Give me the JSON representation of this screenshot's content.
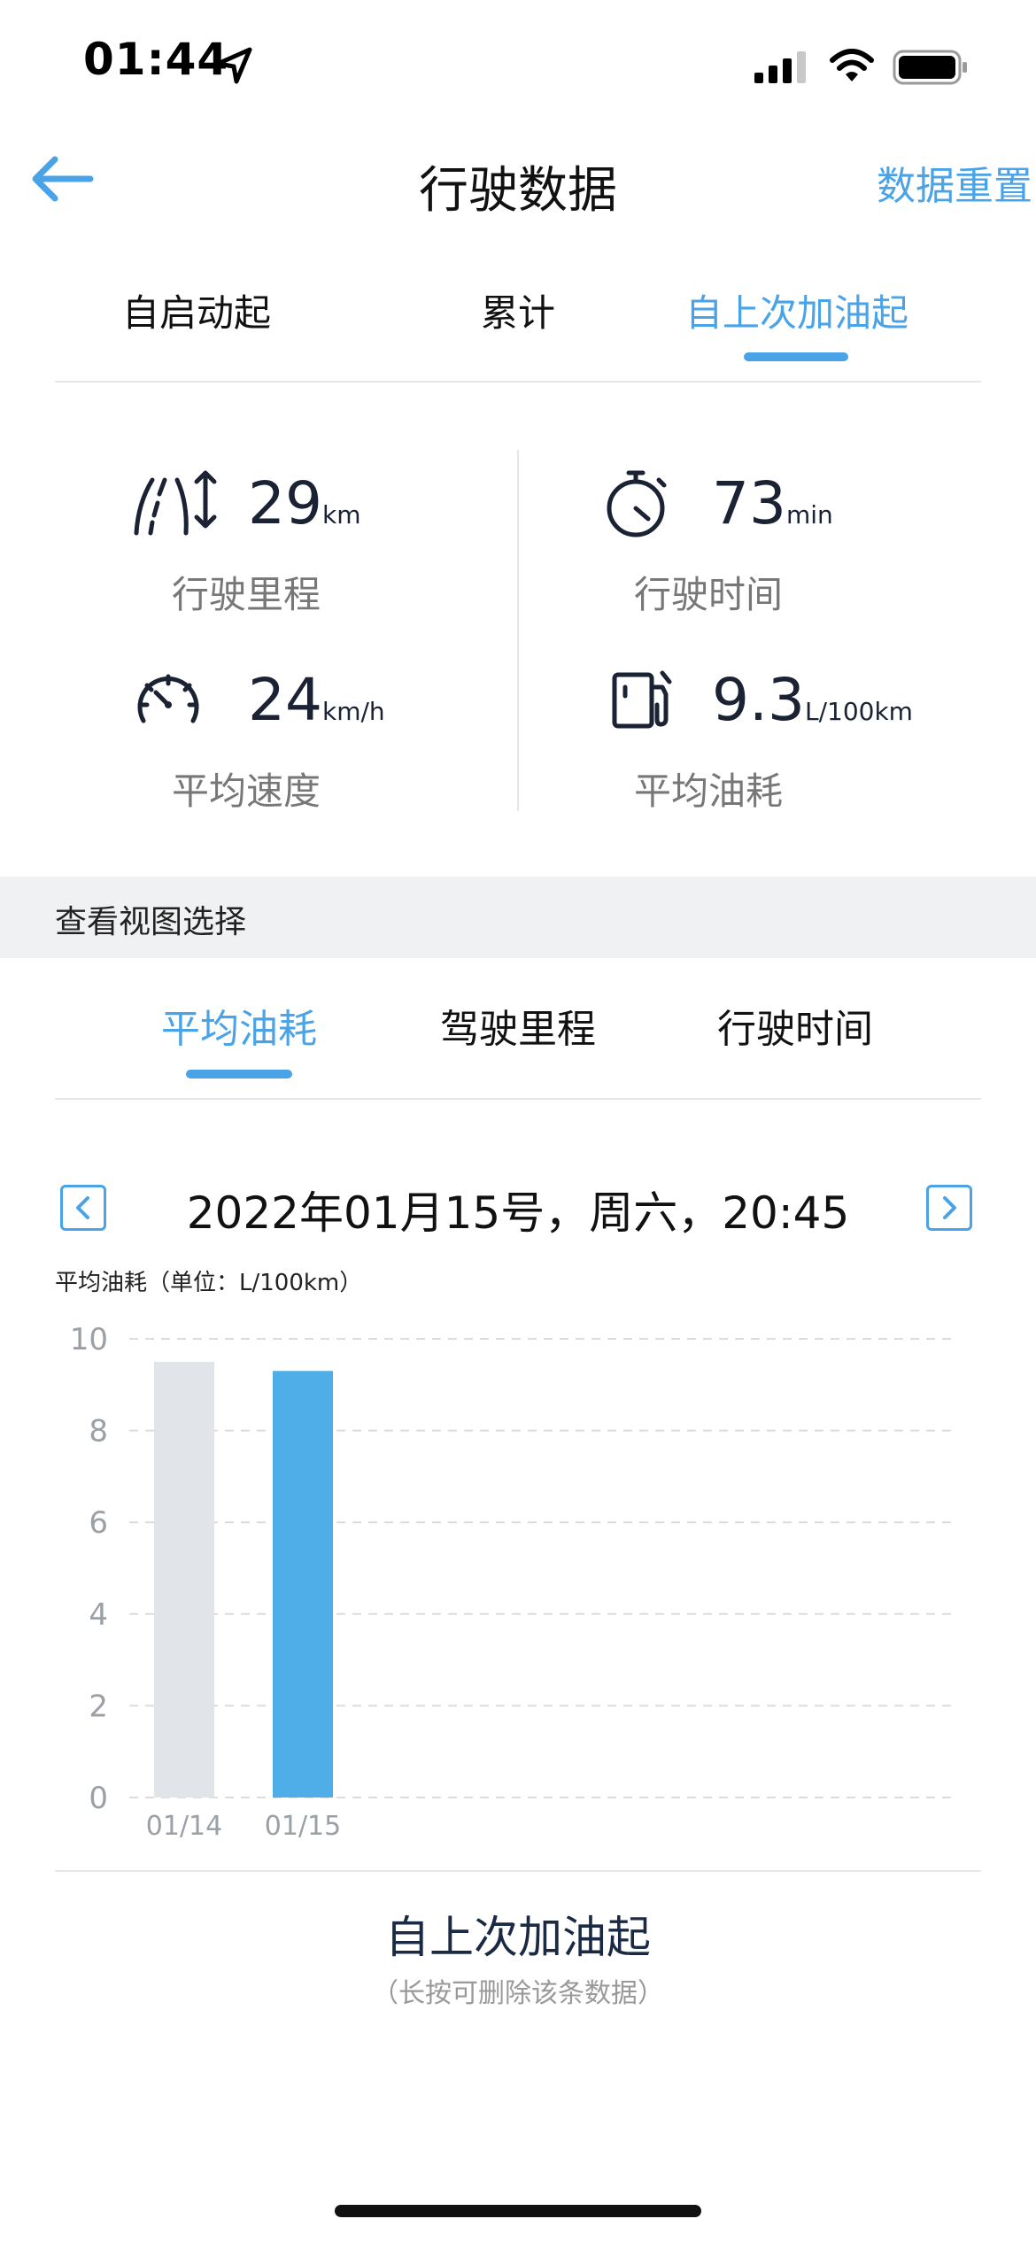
{
  "status_bar": {
    "time": "01:44"
  },
  "nav": {
    "title": "行驶数据",
    "reset_label": "数据重置"
  },
  "top_tabs": [
    {
      "label": "自启动起",
      "active": false
    },
    {
      "label": "累计",
      "active": false
    },
    {
      "label": "自上次加油起",
      "active": true
    }
  ],
  "stats": {
    "distance": {
      "value": "29",
      "unit": "km",
      "label": "行驶里程",
      "icon": "road-distance-icon"
    },
    "time": {
      "value": "73",
      "unit": "min",
      "label": "行驶时间",
      "icon": "stopwatch-icon"
    },
    "speed": {
      "value": "24",
      "unit": "km/h",
      "label": "平均速度",
      "icon": "speedometer-icon"
    },
    "fuel": {
      "value": "9.3",
      "unit": "L/100km",
      "label": "平均油耗",
      "icon": "fuel-pump-icon"
    }
  },
  "view_section": {
    "label": "查看视图选择"
  },
  "view_tabs": [
    {
      "label": "平均油耗",
      "active": true
    },
    {
      "label": "驾驶里程",
      "active": false
    },
    {
      "label": "行驶时间",
      "active": false
    }
  ],
  "date_selector": {
    "text": "2022年01月15号，周六，20:45"
  },
  "chart_data": {
    "type": "bar",
    "title": "平均油耗（单位：L/100km）",
    "categories": [
      "01/14",
      "01/15"
    ],
    "values": [
      9.5,
      9.3
    ],
    "colors": [
      "#e1e4e8",
      "#4faee8"
    ],
    "ylim": [
      0,
      10
    ],
    "yticks": [
      0,
      2,
      4,
      6,
      8,
      10
    ],
    "grid": true
  },
  "footer": {
    "title": "自上次加油起",
    "hint": "（长按可删除该条数据）"
  },
  "colors": {
    "accent": "#4aa3e6"
  }
}
